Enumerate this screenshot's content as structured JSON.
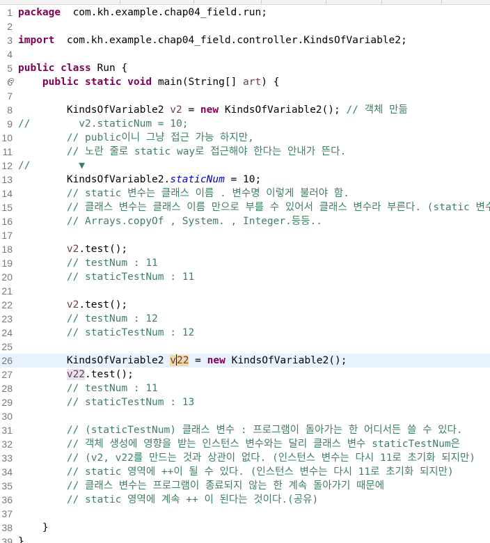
{
  "editor": {
    "lines": [
      {
        "n": "1",
        "t": [
          [
            "kw",
            "package"
          ],
          [
            "",
            "  com.kh.example.chap04_field.run;"
          ]
        ]
      },
      {
        "n": "2",
        "t": []
      },
      {
        "n": "3",
        "t": [
          [
            "kw",
            "import"
          ],
          [
            "",
            "  com.kh.example.chap04_field.controller.KindsOfVariable2;"
          ]
        ]
      },
      {
        "n": "4",
        "t": []
      },
      {
        "n": "5",
        "t": [
          [
            "kw",
            "public"
          ],
          [
            "",
            " "
          ],
          [
            "kw",
            "class"
          ],
          [
            "",
            " Run {"
          ]
        ]
      },
      {
        "n": "6",
        "fold": true,
        "t": [
          [
            "",
            "    "
          ],
          [
            "kw",
            "public"
          ],
          [
            "",
            " "
          ],
          [
            "kw",
            "static"
          ],
          [
            "",
            " "
          ],
          [
            "kw",
            "void"
          ],
          [
            "",
            " main(String[] "
          ],
          [
            "prm",
            "art"
          ],
          [
            "",
            ") {"
          ]
        ]
      },
      {
        "n": "7",
        "t": []
      },
      {
        "n": "8",
        "t": [
          [
            "",
            "        KindsOfVariable2 "
          ],
          [
            "prm",
            "v2"
          ],
          [
            "",
            " = "
          ],
          [
            "kw",
            "new"
          ],
          [
            "",
            " KindsOfVariable2(); "
          ],
          [
            "cm",
            "// 객체 만듦"
          ]
        ]
      },
      {
        "n": "9",
        "t": [
          [
            "cm",
            "//        v2.staticNum = 10;"
          ]
        ]
      },
      {
        "n": "10",
        "t": [
          [
            "",
            "        "
          ],
          [
            "cm",
            "// public이니 그냥 접근 가능 하지만,"
          ]
        ]
      },
      {
        "n": "11",
        "t": [
          [
            "",
            "        "
          ],
          [
            "cm",
            "// 노란 줄로 static way로 접근해야 한다는 안내가 뜬다."
          ]
        ]
      },
      {
        "n": "12",
        "t": [
          [
            "cm",
            "//        ▼"
          ]
        ]
      },
      {
        "n": "13",
        "t": [
          [
            "",
            "        KindsOfVariable2."
          ],
          [
            "sfld",
            "staticNum"
          ],
          [
            "",
            " = 10;"
          ]
        ]
      },
      {
        "n": "14",
        "t": [
          [
            "",
            "        "
          ],
          [
            "cm",
            "// static 변수는 클래스 이름 . 변수명 이렇게 불러야 함."
          ]
        ]
      },
      {
        "n": "15",
        "t": [
          [
            "",
            "        "
          ],
          [
            "cm",
            "// 클래스 변수는 클래스 이름 만으로 부를 수 있어서 클래스 변수라 부른다. (static 변수)"
          ]
        ]
      },
      {
        "n": "16",
        "t": [
          [
            "",
            "        "
          ],
          [
            "cm",
            "// Arrays.copyOf , System. , Integer.등등.."
          ]
        ]
      },
      {
        "n": "17",
        "t": []
      },
      {
        "n": "18",
        "t": [
          [
            "",
            "        "
          ],
          [
            "prm",
            "v2"
          ],
          [
            "",
            ".test();"
          ]
        ]
      },
      {
        "n": "19",
        "t": [
          [
            "",
            "        "
          ],
          [
            "cm",
            "// testNum : 11"
          ]
        ]
      },
      {
        "n": "20",
        "t": [
          [
            "",
            "        "
          ],
          [
            "cm",
            "// staticTestNum : 11"
          ]
        ]
      },
      {
        "n": "21",
        "t": []
      },
      {
        "n": "22",
        "t": [
          [
            "",
            "        "
          ],
          [
            "prm",
            "v2"
          ],
          [
            "",
            ".test();"
          ]
        ]
      },
      {
        "n": "23",
        "t": [
          [
            "",
            "        "
          ],
          [
            "cm",
            "// testNum : 12"
          ]
        ]
      },
      {
        "n": "24",
        "t": [
          [
            "",
            "        "
          ],
          [
            "cm",
            "// staticTestNum : 12"
          ]
        ]
      },
      {
        "n": "25",
        "t": []
      },
      {
        "n": "26",
        "current": true,
        "t": [
          [
            "",
            "        KindsOfVariable2 "
          ],
          [
            "prm occ",
            "v"
          ],
          [
            "caret",
            ""
          ],
          [
            "prm occ",
            "22"
          ],
          [
            "",
            " = "
          ],
          [
            "kw",
            "new"
          ],
          [
            "",
            " KindsOfVariable2();"
          ]
        ]
      },
      {
        "n": "27",
        "t": [
          [
            "",
            "        "
          ],
          [
            "prm ovl",
            "v22"
          ],
          [
            "",
            ".test();"
          ]
        ]
      },
      {
        "n": "28",
        "t": [
          [
            "",
            "        "
          ],
          [
            "cm",
            "// testNum : 11"
          ]
        ]
      },
      {
        "n": "29",
        "t": [
          [
            "",
            "        "
          ],
          [
            "cm",
            "// staticTestNum : 13"
          ]
        ]
      },
      {
        "n": "30",
        "t": []
      },
      {
        "n": "31",
        "t": [
          [
            "",
            "        "
          ],
          [
            "cm",
            "// (staticTestNum) 클래스 변수 : 프로그램이 돌아가는 한 어디서든 쓸 수 있다."
          ]
        ]
      },
      {
        "n": "32",
        "t": [
          [
            "",
            "        "
          ],
          [
            "cm",
            "// 객체 생성에 영향을 받는 인스턴스 변수와는 달리 클래스 변수 staticTestNum은"
          ]
        ]
      },
      {
        "n": "33",
        "t": [
          [
            "",
            "        "
          ],
          [
            "cm",
            "// (v2, v22를 만드는 것과 상관이 없다. (인스턴스 변수는 다시 11로 초기화 되지만)"
          ]
        ]
      },
      {
        "n": "34",
        "t": [
          [
            "",
            "        "
          ],
          [
            "cm",
            "// static 영역에 ++이 될 수 있다. (인스턴스 변수는 다시 11로 초기화 되지만)"
          ]
        ]
      },
      {
        "n": "35",
        "t": [
          [
            "",
            "        "
          ],
          [
            "cm",
            "// 클래스 변수는 프로그램이 종료되지 않는 한 계속 돌아가기 때문에"
          ]
        ]
      },
      {
        "n": "36",
        "t": [
          [
            "",
            "        "
          ],
          [
            "cm",
            "// static 영역에 계속 ++ 이 된다는 것이다.(공유)"
          ]
        ]
      },
      {
        "n": "37",
        "t": []
      },
      {
        "n": "38",
        "t": [
          [
            "",
            "    }"
          ]
        ]
      },
      {
        "n": "39",
        "t": [
          [
            "",
            "}"
          ]
        ]
      }
    ]
  }
}
